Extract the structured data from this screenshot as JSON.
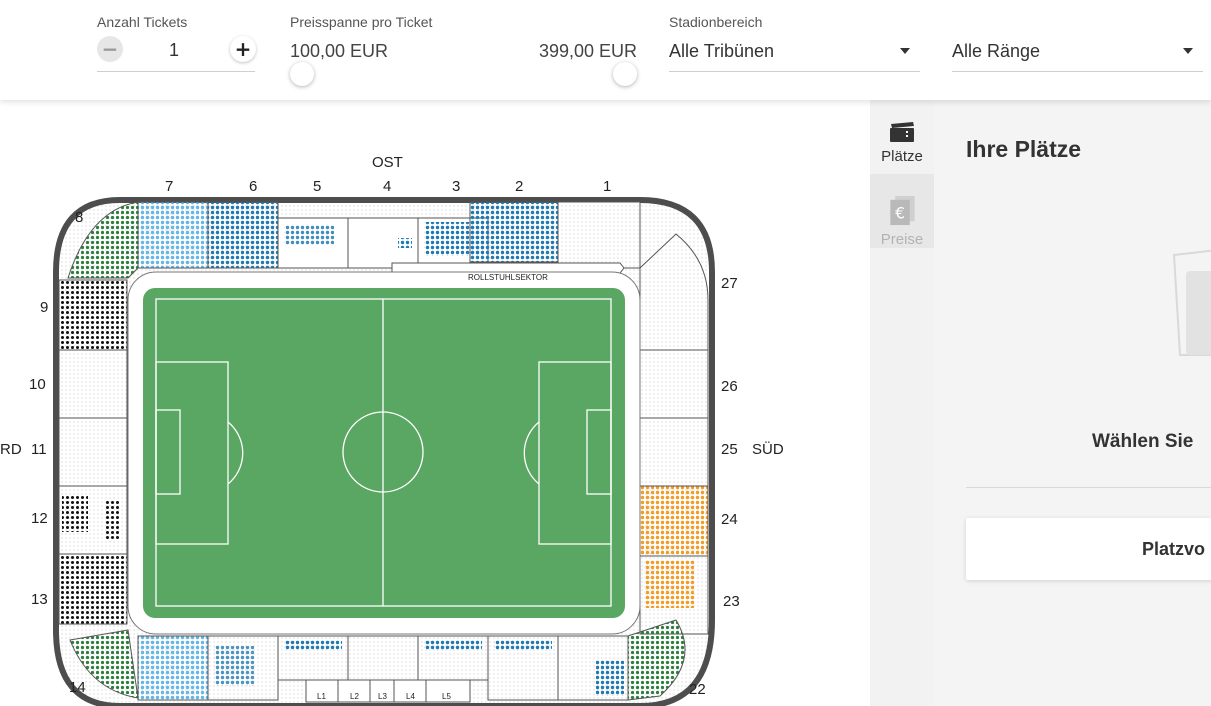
{
  "filters": {
    "tickets": {
      "label": "Anzahl Tickets",
      "value": "1",
      "minus_icon": "minus-icon",
      "plus_icon": "plus-icon"
    },
    "price": {
      "label": "Preisspanne pro Ticket",
      "min": "100,00 EUR",
      "max": "399,00 EUR"
    },
    "area": {
      "label": "Stadionbereich",
      "value": "Alle Tribünen"
    },
    "rank": {
      "value": "Alle Ränge"
    }
  },
  "stadium": {
    "stands": {
      "east": "OST",
      "south": "SÜD",
      "north": "RD"
    },
    "wheelchair": "ROLLSTUHLSEKTOR",
    "lower_labels": [
      "L1",
      "L2",
      "L3",
      "L4",
      "L5"
    ],
    "block_numbers": [
      "1",
      "2",
      "3",
      "4",
      "5",
      "6",
      "7",
      "8",
      "9",
      "10",
      "11",
      "12",
      "13",
      "14",
      "22",
      "23",
      "24",
      "25",
      "26",
      "27"
    ],
    "colors": {
      "pitch": "#5aa763",
      "dark_blue": "#1f79b2",
      "light_blue": "#64b5e8",
      "green": "#2a7f3a",
      "orange": "#f49b21",
      "black": "#111111",
      "frame": "#4d4d4d"
    }
  },
  "tabs": [
    {
      "label": "Plätze",
      "icon": "ticket-icon"
    },
    {
      "label": "Preise",
      "icon": "euro-icon"
    }
  ],
  "panel": {
    "title": "Ihre Plätze",
    "hint": "Wählen Sie",
    "button": "Platzvo"
  }
}
